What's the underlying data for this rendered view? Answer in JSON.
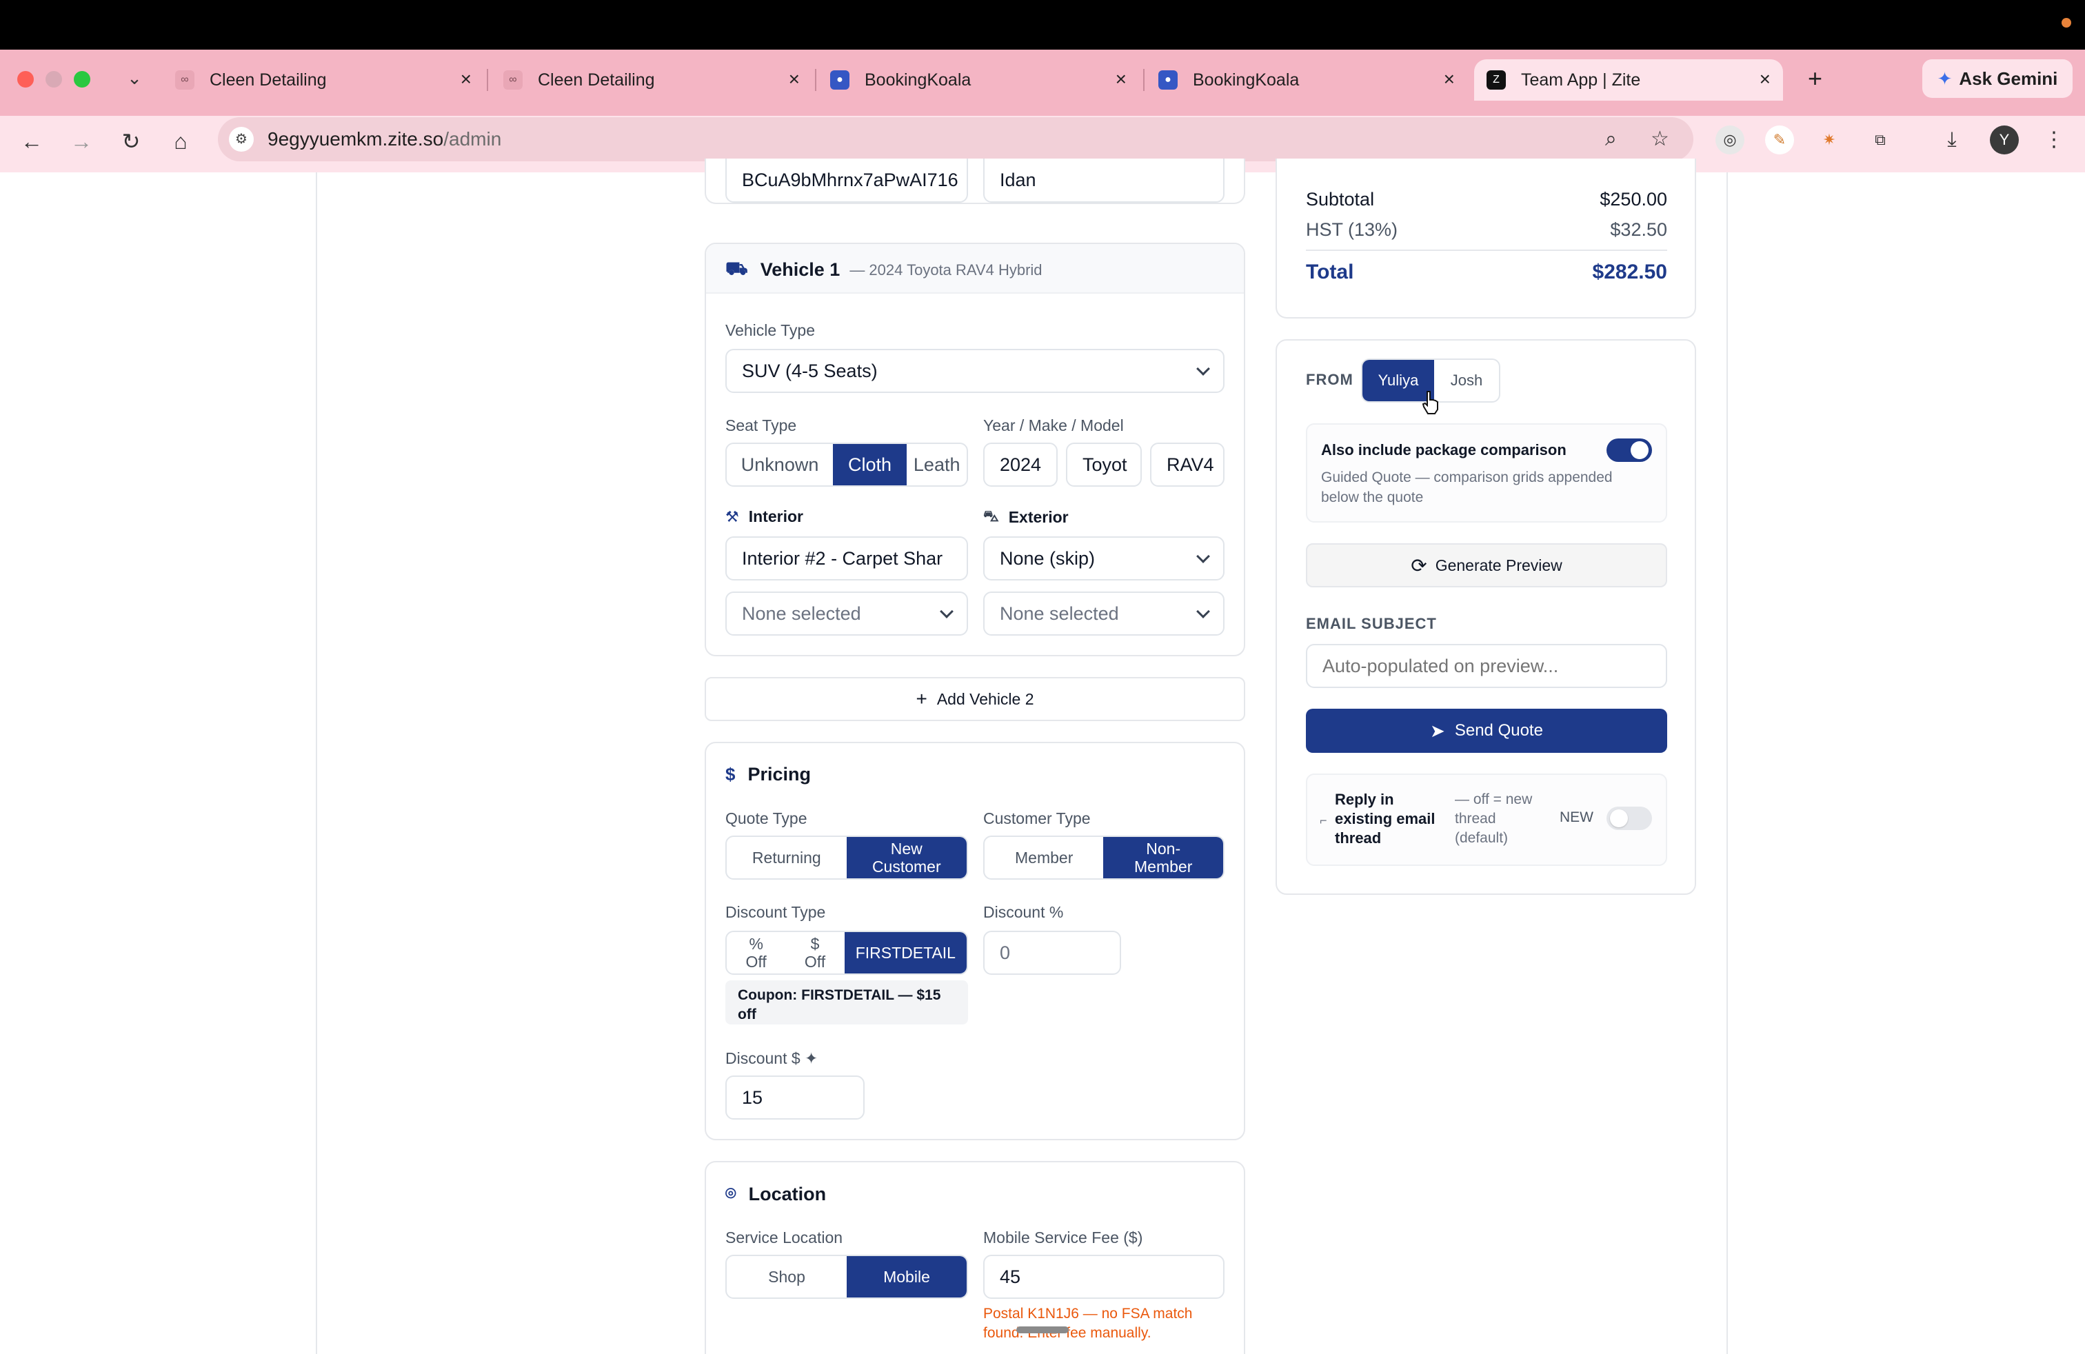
{
  "browser": {
    "tabs": [
      {
        "title": "Cleen Detailing",
        "favicon": "cleen-logo-icon"
      },
      {
        "title": "Cleen Detailing",
        "favicon": "cleen-logo-icon"
      },
      {
        "title": "BookingKoala",
        "favicon": "bookingkoala-icon"
      },
      {
        "title": "BookingKoala",
        "favicon": "bookingkoala-icon"
      },
      {
        "title": "Team App | Zite",
        "favicon": "zite-icon"
      }
    ],
    "ask_gemini": "Ask Gemini",
    "url_host": "9egyyuemkm.zite.so",
    "url_path": "/admin",
    "profile_initial": "Y"
  },
  "customer": {
    "id_value": "BCuA9bMhrnx7aPwAI716",
    "name_value": "Idan"
  },
  "vehicle": {
    "title": "Vehicle 1",
    "subtitle": "— 2024 Toyota RAV4 Hybrid",
    "vehicle_type_label": "Vehicle Type",
    "vehicle_type_value": "SUV (4-5 Seats)",
    "seat_type_label": "Seat Type",
    "seat_options": [
      "Unknown",
      "Cloth",
      "Leath"
    ],
    "seat_selected": "Cloth",
    "ymm_label": "Year / Make / Model",
    "year": "2024",
    "make": "Toyot",
    "model": "RAV4",
    "interior_label": "Interior",
    "interior_value": "Interior #2 - Carpet Shar",
    "interior_addon": "None selected",
    "exterior_label": "Exterior",
    "exterior_value": "None (skip)",
    "exterior_addon": "None selected",
    "add_vehicle": "Add Vehicle 2"
  },
  "pricing": {
    "title": "Pricing",
    "quote_type_label": "Quote Type",
    "quote_options": [
      "Returning",
      "New Customer"
    ],
    "customer_type_label": "Customer Type",
    "customer_options": [
      "Member",
      "Non-Member"
    ],
    "discount_type_label": "Discount Type",
    "discount_options": [
      "% Off",
      "$ Off",
      "FIRSTDETAIL"
    ],
    "coupon_note": "Coupon: FIRSTDETAIL — $15 off",
    "discount_pct_label": "Discount %",
    "discount_pct_value": "0",
    "discount_amt_label": "Discount $ ✦",
    "discount_amt_value": "15"
  },
  "location": {
    "title": "Location",
    "service_location_label": "Service Location",
    "service_options": [
      "Shop",
      "Mobile"
    ],
    "fee_label": "Mobile Service Fee ($)",
    "fee_value": "45",
    "warning": "Postal K1N1J6 — no FSA match found. Enter fee manually."
  },
  "summary": {
    "subtotal_label": "Subtotal",
    "subtotal_value": "$250.00",
    "hst_label": "HST (13%)",
    "hst_value": "$32.50",
    "total_label": "Total",
    "total_value": "$282.50"
  },
  "send": {
    "from_label": "FROM",
    "from_options": [
      "Yuliya",
      "Josh"
    ],
    "compare_title": "Also include package comparison",
    "compare_desc": "Guided Quote — comparison grids appended below the quote",
    "generate_preview": "Generate Preview",
    "email_subject_label": "EMAIL SUBJECT",
    "email_subject_placeholder": "Auto-populated on preview...",
    "send_quote": "Send Quote",
    "reply_title": "Reply in existing email thread",
    "reply_desc": "— off = new thread (default)",
    "reply_badge": "NEW"
  },
  "colors": {
    "primary": "#1e3a8a",
    "tab_strip": "#f4b5c4",
    "warning": "#ea580c"
  }
}
